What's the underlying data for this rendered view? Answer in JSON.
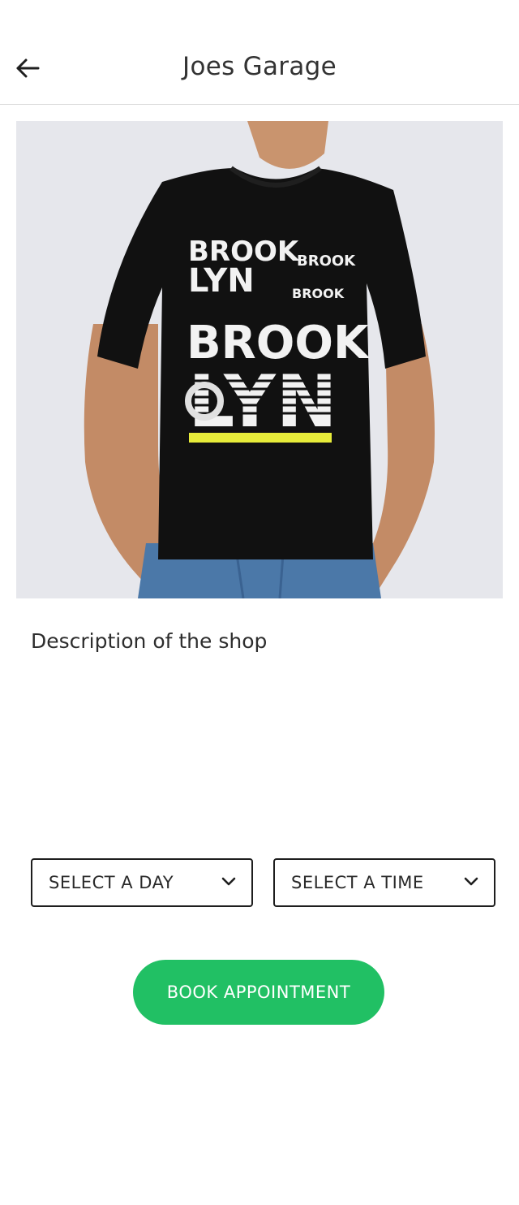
{
  "header": {
    "title": "Joes Garage",
    "back_icon": "arrow-left-icon"
  },
  "hero": {
    "shirt_print_lines": [
      "BROOK",
      "BROOK",
      "LYN",
      "BROOK",
      "BROOK",
      "LYN"
    ]
  },
  "shop": {
    "description": "Description of the shop"
  },
  "booking": {
    "day_select_label": "SELECT A DAY",
    "time_select_label": "SELECT A TIME",
    "book_button_label": "BOOK APPOINTMENT",
    "accent_color": "#21c064"
  }
}
